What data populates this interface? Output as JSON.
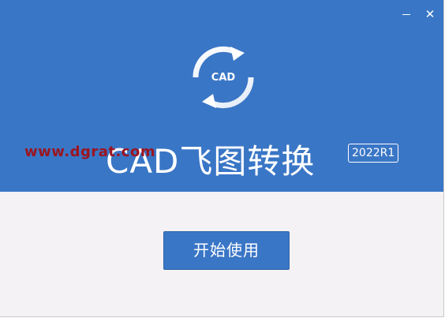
{
  "window": {
    "minimize_label": "",
    "close_label": "✕"
  },
  "logo": {
    "text": "CAD",
    "icon": "sync-arrows-icon"
  },
  "watermark": {
    "text": "www.dgrat.com"
  },
  "app": {
    "title": "CAD飞图转换",
    "version": "2022R1"
  },
  "actions": {
    "start_label": "开始使用"
  },
  "colors": {
    "header_bg": "#3a76c6",
    "body_bg": "#f4f2f4",
    "button_bg": "#3a76c6",
    "watermark": "#9b1520",
    "text_light": "#ffffff"
  }
}
